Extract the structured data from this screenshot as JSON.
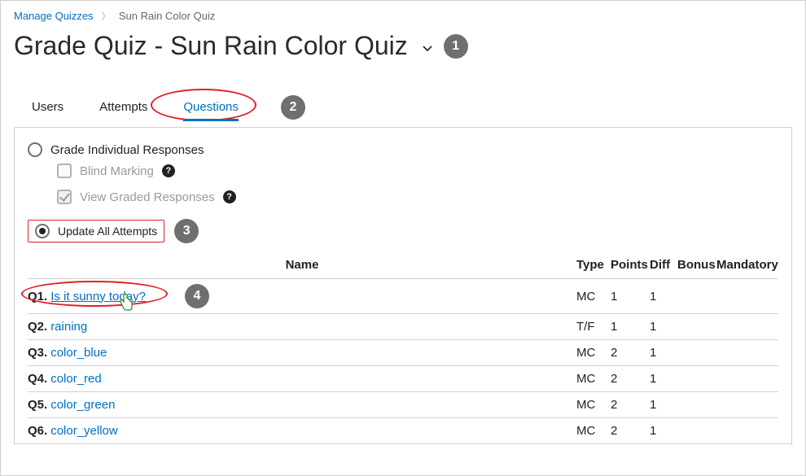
{
  "breadcrumb": {
    "parent_label": "Manage Quizzes",
    "current_label": "Sun Rain Color Quiz"
  },
  "page": {
    "title": "Grade Quiz - Sun Rain Color Quiz"
  },
  "tabs": {
    "users": "Users",
    "attempts": "Attempts",
    "questions": "Questions"
  },
  "callouts": {
    "c1": "1",
    "c2": "2",
    "c3": "3",
    "c4": "4"
  },
  "options": {
    "grade_individual_label": "Grade Individual Responses",
    "blind_marking_label": "Blind Marking",
    "view_graded_label": "View Graded Responses",
    "update_all_label": "Update All Attempts"
  },
  "table": {
    "headers": {
      "name": "Name",
      "type": "Type",
      "points": "Points",
      "diff": "Diff",
      "bonus": "Bonus",
      "mandatory": "Mandatory"
    },
    "rows": [
      {
        "num": "Q1.",
        "name": "Is it sunny today?",
        "type": "MC",
        "points": "1",
        "diff": "1",
        "bonus": "",
        "mandatory": ""
      },
      {
        "num": "Q2.",
        "name": "raining",
        "type": "T/F",
        "points": "1",
        "diff": "1",
        "bonus": "",
        "mandatory": ""
      },
      {
        "num": "Q3.",
        "name": "color_blue",
        "type": "MC",
        "points": "2",
        "diff": "1",
        "bonus": "",
        "mandatory": ""
      },
      {
        "num": "Q4.",
        "name": "color_red",
        "type": "MC",
        "points": "2",
        "diff": "1",
        "bonus": "",
        "mandatory": ""
      },
      {
        "num": "Q5.",
        "name": "color_green",
        "type": "MC",
        "points": "2",
        "diff": "1",
        "bonus": "",
        "mandatory": ""
      },
      {
        "num": "Q6.",
        "name": "color_yellow",
        "type": "MC",
        "points": "2",
        "diff": "1",
        "bonus": "",
        "mandatory": ""
      }
    ]
  }
}
